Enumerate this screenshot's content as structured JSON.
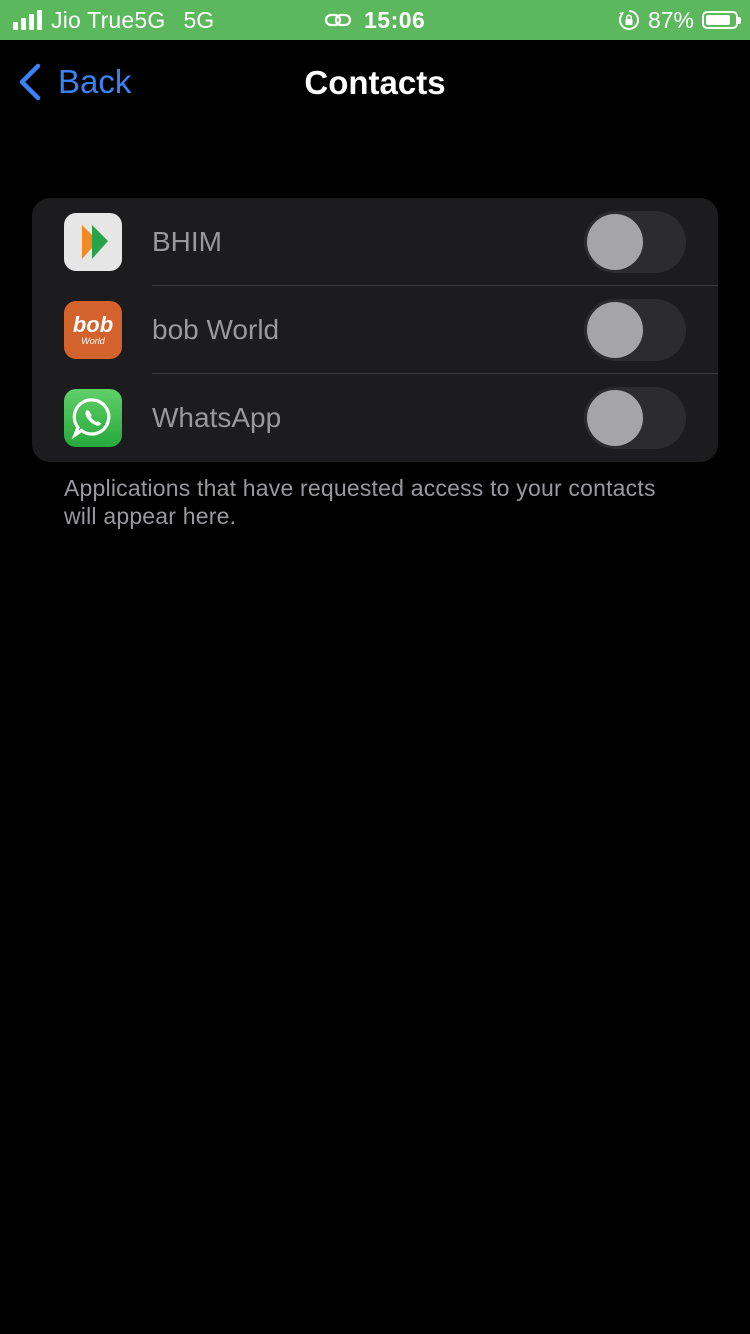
{
  "status_bar": {
    "carrier": "Jio True5G",
    "network": "5G",
    "time": "15:06",
    "battery_percent": "87%",
    "battery_level": 0.87,
    "background_color": "#5cb85c",
    "icons": [
      "signal-icon",
      "link-icon",
      "orientation-lock-icon",
      "battery-icon"
    ]
  },
  "nav": {
    "back_label": "Back",
    "title": "Contacts",
    "accent_color": "#3a82f7"
  },
  "apps": [
    {
      "name": "BHIM",
      "icon": "bhim-app-icon",
      "enabled": false
    },
    {
      "name": "bob World",
      "icon": "bob-world-app-icon",
      "enabled": false,
      "icon_text": "bob",
      "icon_subtext": "World"
    },
    {
      "name": "WhatsApp",
      "icon": "whatsapp-app-icon",
      "enabled": false
    }
  ],
  "footer_note": "Applications that have requested access to your contacts will appear here."
}
